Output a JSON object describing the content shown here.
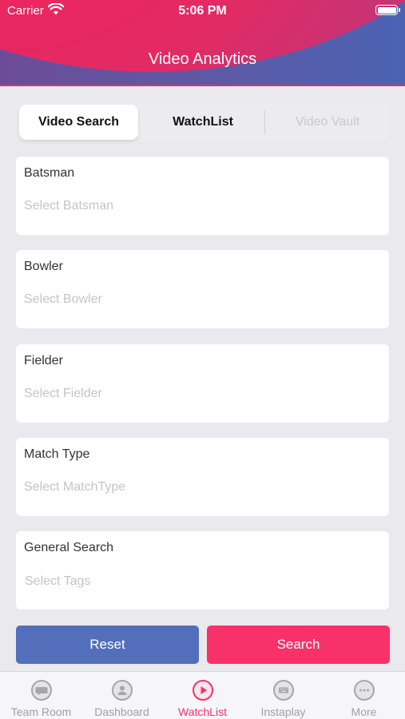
{
  "status_bar": {
    "carrier": "Carrier",
    "time": "5:06 PM"
  },
  "header": {
    "title": "Video Analytics"
  },
  "segments": {
    "video_search": "Video Search",
    "watchlist": "WatchList",
    "video_vault": "Video Vault"
  },
  "fields": {
    "batsman": {
      "label": "Batsman",
      "placeholder": "Select Batsman"
    },
    "bowler": {
      "label": "Bowler",
      "placeholder": "Select Bowler"
    },
    "fielder": {
      "label": "Fielder",
      "placeholder": "Select Fielder"
    },
    "match_type": {
      "label": "Match Type",
      "placeholder": "Select MatchType"
    },
    "general_search": {
      "label": "General Search",
      "placeholder": "Select Tags"
    }
  },
  "buttons": {
    "reset": "Reset",
    "search": "Search"
  },
  "tabbar": {
    "team_room": "Team Room",
    "dashboard": "Dashboard",
    "watchlist": "WatchList",
    "instaplay": "Instaplay",
    "more": "More"
  },
  "colors": {
    "accent": "#f2336c",
    "reset_button": "#536fbb",
    "search_button": "#f8316a"
  },
  "icons": [
    "wifi-icon",
    "battery-icon",
    "chat-bubble-icon",
    "user-icon",
    "play-icon",
    "keyboard-icon",
    "more-dots-icon"
  ]
}
